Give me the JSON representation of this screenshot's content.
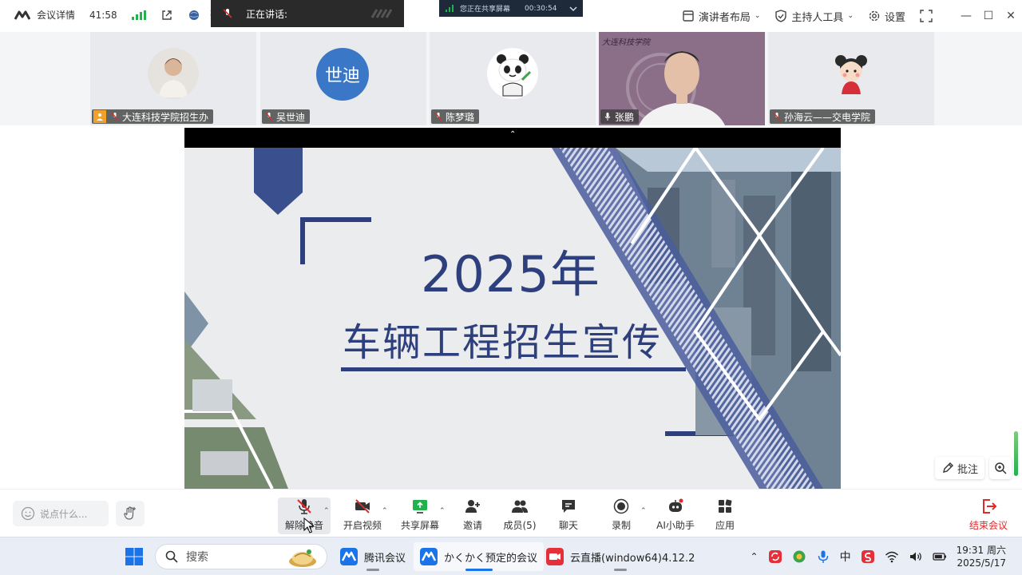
{
  "topbar": {
    "meeting_details": "会议详情",
    "duration": "41:58",
    "host_name_short": "张鹏",
    "speaking_label": "正在讲话:",
    "share_status": "您正在共享屏幕",
    "share_timer": "00:30:54",
    "presenter_layout": "演讲者布局",
    "host_tools": "主持人工具",
    "settings": "设置"
  },
  "participants": [
    {
      "name": "大连科技学院招生办",
      "is_host": true,
      "avatar": "photo-avatar"
    },
    {
      "name": "吴世迪",
      "avatar_text": "世迪",
      "avatar_color": "#3a78c7"
    },
    {
      "name": "陈梦璐",
      "avatar": "panda-avatar"
    },
    {
      "name": "张鹏",
      "avatar": "live-video",
      "watermark": "大连科技学院"
    },
    {
      "name": "孙海云——交电学院",
      "avatar": "cartoon-avatar"
    }
  ],
  "slide": {
    "year": "2025年",
    "title": "车辆工程招生宣传",
    "accent_color": "#2d3f7c"
  },
  "content_tools": {
    "annotate": "批注"
  },
  "toolbar": {
    "chat_placeholder": "说点什么...",
    "unmute": "解除静音",
    "start_video": "开启视频",
    "share_screen": "共享屏幕",
    "invite": "邀请",
    "members": "成员(5)",
    "chat": "聊天",
    "record": "录制",
    "ai_assistant": "AI小助手",
    "apps": "应用",
    "end_meeting": "结束会议"
  },
  "taskbar": {
    "search": "搜索",
    "apps": [
      {
        "label": "腾讯会议",
        "active": false
      },
      {
        "label": "かくかく预定的会议",
        "active": true
      },
      {
        "label": "云直播(window64)4.12.2",
        "active": false
      }
    ],
    "ime": "中",
    "time": "19:31 周六",
    "date": "2025/5/17"
  }
}
